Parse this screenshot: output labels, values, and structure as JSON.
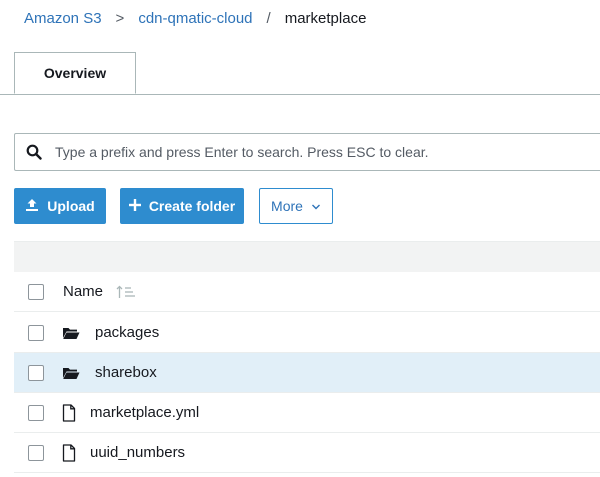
{
  "breadcrumb": {
    "items": [
      "Amazon S3",
      "cdn-qmatic-cloud"
    ],
    "separators": [
      ">",
      "/"
    ],
    "current": "marketplace"
  },
  "tabs": [
    {
      "label": "Overview"
    }
  ],
  "search": {
    "placeholder": "Type a prefix and press Enter to search. Press ESC to clear.",
    "value": ""
  },
  "toolbar": {
    "upload_label": "Upload",
    "create_folder_label": "Create folder",
    "more_label": "More"
  },
  "table": {
    "header": {
      "name_label": "Name"
    },
    "rows": [
      {
        "name": "packages",
        "type": "folder",
        "selected": false
      },
      {
        "name": "sharebox",
        "type": "folder",
        "selected": true
      },
      {
        "name": "marketplace.yml",
        "type": "file",
        "selected": false
      },
      {
        "name": "uuid_numbers",
        "type": "file",
        "selected": false
      }
    ]
  },
  "colors": {
    "link": "#2e73b8",
    "primary_button": "#2e8ccf",
    "selected_row": "#e1eff8"
  },
  "icons": [
    "search-icon",
    "upload-icon",
    "plus-icon",
    "chevron-down-icon",
    "sort-icon",
    "folder-icon",
    "file-icon"
  ]
}
